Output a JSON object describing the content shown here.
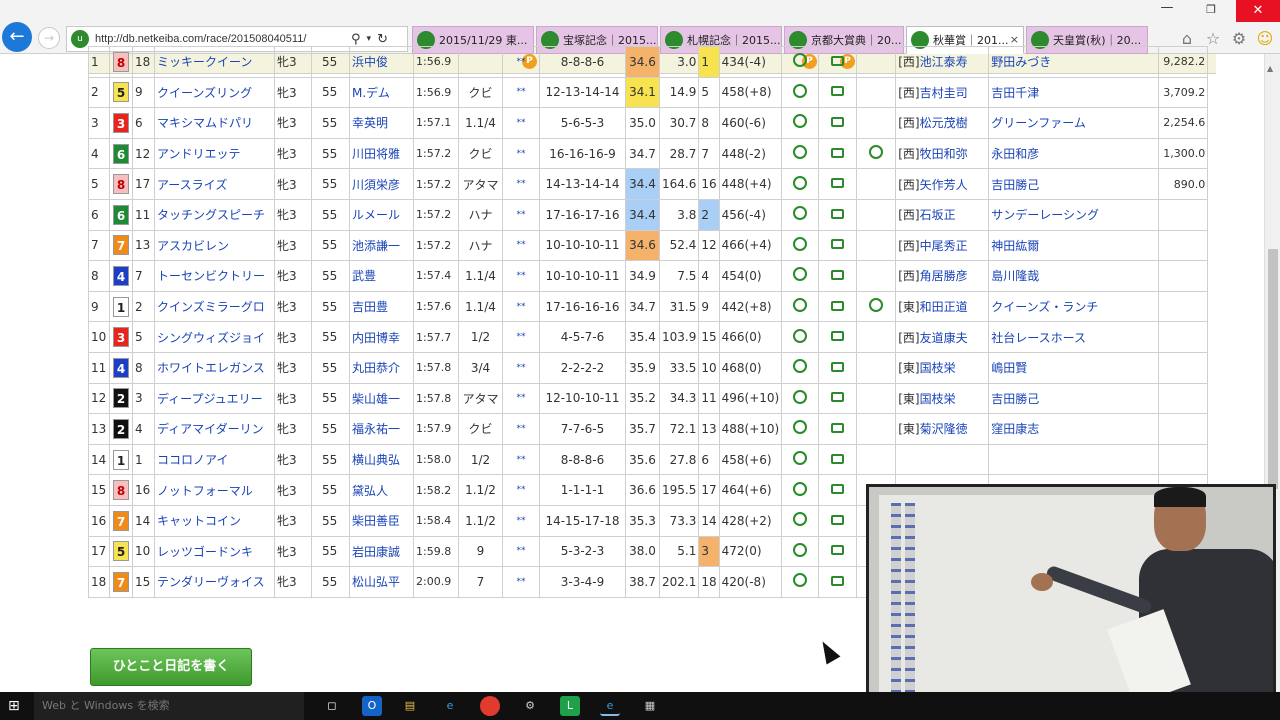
{
  "browser": {
    "url": "http://db.netkeiba.com/race/201508040511/",
    "tabs": [
      {
        "label": "2015/11/29 東...",
        "active": false
      },
      {
        "label": "宝塚記念｜2015...",
        "active": false
      },
      {
        "label": "札幌記念｜2015...",
        "active": false
      },
      {
        "label": "京都大賞典｜20...",
        "active": false
      },
      {
        "label": "秋華賞｜201...",
        "active": true
      },
      {
        "label": "天皇賞(秋)｜20...",
        "active": false
      }
    ],
    "close_tab_glyph": "×"
  },
  "colors": {
    "accent": "#1e78d8",
    "tab_inactive": "#e6c4e6",
    "link_blue": "#1a44b8",
    "orange_cell": "#f5b26b",
    "blue_cell": "#a9cff7",
    "yellow_cell": "#f7e24f",
    "green_icon": "#2b8a2b"
  },
  "icons": {
    "back": "back-arrow-icon",
    "forward": "forward-arrow-icon",
    "search": "search-icon",
    "refresh": "refresh-icon",
    "home": "home-icon",
    "star": "star-icon",
    "gear": "gear-icon",
    "smiley": "smiley-icon",
    "row_icon_a": "clock-icon",
    "row_icon_b": "speech-icon"
  },
  "table": {
    "rows": [
      {
        "rank": "1",
        "waku": "8",
        "waku_color": "#f6c0c0",
        "waku_text": "#c00000",
        "num": "18",
        "name": "ミッキークイーン",
        "sex": "牝3",
        "weight": "55",
        "jockey": "浜中俊",
        "time": "1:56.9",
        "margin": "",
        "mark": "**",
        "passing": "8-8-8-6",
        "f3": "34.6",
        "f3_color": "orange",
        "odds": "3.0",
        "pop": "1",
        "pop_color": "yellow",
        "body": "434(-4)",
        "extra": "",
        "region": "[西]",
        "trainer": "池江泰寿",
        "owner": "野田みづき",
        "prize": "9,282.2"
      },
      {
        "rank": "2",
        "waku": "5",
        "waku_color": "#f7e24f",
        "waku_text": "#222",
        "num": "9",
        "name": "クイーンズリング",
        "sex": "牝3",
        "weight": "55",
        "jockey": "M.デム",
        "time": "1:56.9",
        "margin": "クビ",
        "mark": "**",
        "passing": "12-13-14-14",
        "f3": "34.1",
        "f3_color": "yellow",
        "odds": "14.9",
        "pop": "5",
        "pop_color": "",
        "body": "458(+8)",
        "extra": "",
        "region": "[西]",
        "trainer": "吉村圭司",
        "owner": "吉田千津",
        "prize": "3,709.2"
      },
      {
        "rank": "3",
        "waku": "3",
        "waku_color": "#e8241c",
        "waku_text": "#fff",
        "num": "6",
        "name": "マキシマムドパリ",
        "sex": "牝3",
        "weight": "55",
        "jockey": "幸英明",
        "time": "1:57.1",
        "margin": "1.1/4",
        "mark": "**",
        "passing": "5-6-5-3",
        "f3": "35.0",
        "f3_color": "",
        "odds": "30.7",
        "pop": "8",
        "pop_color": "",
        "body": "460(-6)",
        "extra": "",
        "region": "[西]",
        "trainer": "松元茂樹",
        "owner": "グリーンファーム",
        "prize": "2,254.6"
      },
      {
        "rank": "4",
        "waku": "6",
        "waku_color": "#1f8a35",
        "waku_text": "#fff",
        "num": "12",
        "name": "アンドリエッテ",
        "sex": "牝3",
        "weight": "55",
        "jockey": "川田将雅",
        "time": "1:57.2",
        "margin": "クビ",
        "mark": "**",
        "passing": "16-16-16-9",
        "f3": "34.7",
        "f3_color": "",
        "odds": "28.7",
        "pop": "7",
        "pop_color": "",
        "body": "448(-2)",
        "extra": "!",
        "region": "[西]",
        "trainer": "牧田和弥",
        "owner": "永田和彦",
        "prize": "1,300.0"
      },
      {
        "rank": "5",
        "waku": "8",
        "waku_color": "#f6c0c0",
        "waku_text": "#c00000",
        "num": "17",
        "name": "アースライズ",
        "sex": "牝3",
        "weight": "55",
        "jockey": "川須栄彦",
        "time": "1:57.2",
        "margin": "アタマ",
        "mark": "**",
        "passing": "14-13-14-14",
        "f3": "34.4",
        "f3_color": "blue",
        "odds": "164.6",
        "pop": "16",
        "pop_color": "",
        "body": "448(+4)",
        "extra": "",
        "region": "[西]",
        "trainer": "矢作芳人",
        "owner": "吉田勝己",
        "prize": "890.0"
      },
      {
        "rank": "6",
        "waku": "6",
        "waku_color": "#1f8a35",
        "waku_text": "#fff",
        "num": "11",
        "name": "タッチングスピーチ",
        "sex": "牝3",
        "weight": "55",
        "jockey": "ルメール",
        "time": "1:57.2",
        "margin": "ハナ",
        "mark": "**",
        "passing": "17-16-17-16",
        "f3": "34.4",
        "f3_color": "blue",
        "odds": "3.8",
        "pop": "2",
        "pop_color": "blue",
        "body": "456(-4)",
        "extra": "",
        "region": "[西]",
        "trainer": "石坂正",
        "owner": "サンデーレーシング",
        "prize": ""
      },
      {
        "rank": "7",
        "waku": "7",
        "waku_color": "#f08a18",
        "waku_text": "#fff",
        "num": "13",
        "name": "アスカビレン",
        "sex": "牝3",
        "weight": "55",
        "jockey": "池添謙一",
        "time": "1:57.2",
        "margin": "ハナ",
        "mark": "**",
        "passing": "10-10-10-11",
        "f3": "34.6",
        "f3_color": "orange",
        "odds": "52.4",
        "pop": "12",
        "pop_color": "",
        "body": "466(+4)",
        "extra": "",
        "region": "[西]",
        "trainer": "中尾秀正",
        "owner": "神田紘爾",
        "prize": ""
      },
      {
        "rank": "8",
        "waku": "4",
        "waku_color": "#1d3fc8",
        "waku_text": "#fff",
        "num": "7",
        "name": "トーセンビクトリー",
        "sex": "牝3",
        "weight": "55",
        "jockey": "武豊",
        "time": "1:57.4",
        "margin": "1.1/4",
        "mark": "**",
        "passing": "10-10-10-11",
        "f3": "34.9",
        "f3_color": "",
        "odds": "7.5",
        "pop": "4",
        "pop_color": "",
        "body": "454(0)",
        "extra": "",
        "region": "[西]",
        "trainer": "角居勝彦",
        "owner": "島川隆哉",
        "prize": ""
      },
      {
        "rank": "9",
        "waku": "1",
        "waku_color": "#ffffff",
        "waku_text": "#222",
        "num": "2",
        "name": "クインズミラーグロ",
        "sex": "牝3",
        "weight": "55",
        "jockey": "吉田豊",
        "time": "1:57.6",
        "margin": "1.1/4",
        "mark": "**",
        "passing": "17-16-16-16",
        "f3": "34.7",
        "f3_color": "",
        "odds": "31.5",
        "pop": "9",
        "pop_color": "",
        "body": "442(+8)",
        "extra": "!",
        "region": "[東]",
        "trainer": "和田正道",
        "owner": "クイーンズ・ランチ",
        "prize": ""
      },
      {
        "rank": "10",
        "waku": "3",
        "waku_color": "#e8241c",
        "waku_text": "#fff",
        "num": "5",
        "name": "シングウィズジョイ",
        "sex": "牝3",
        "weight": "55",
        "jockey": "内田博幸",
        "time": "1:57.7",
        "margin": "1/2",
        "mark": "**",
        "passing": "4-5-7-6",
        "f3": "35.4",
        "f3_color": "",
        "odds": "103.9",
        "pop": "15",
        "pop_color": "",
        "body": "466(0)",
        "extra": "",
        "region": "[西]",
        "trainer": "友道康夫",
        "owner": "社台レースホース",
        "prize": ""
      },
      {
        "rank": "11",
        "waku": "4",
        "waku_color": "#1d3fc8",
        "waku_text": "#fff",
        "num": "8",
        "name": "ホワイトエレガンス",
        "sex": "牝3",
        "weight": "55",
        "jockey": "丸田恭介",
        "time": "1:57.8",
        "margin": "3/4",
        "mark": "**",
        "passing": "2-2-2-2",
        "f3": "35.9",
        "f3_color": "",
        "odds": "33.5",
        "pop": "10",
        "pop_color": "",
        "body": "468(0)",
        "extra": "",
        "region": "[東]",
        "trainer": "国枝栄",
        "owner": "嶋田賢",
        "prize": ""
      },
      {
        "rank": "12",
        "waku": "2",
        "waku_color": "#111111",
        "waku_text": "#fff",
        "num": "3",
        "name": "ディープジュエリー",
        "sex": "牝3",
        "weight": "55",
        "jockey": "柴山雄一",
        "time": "1:57.8",
        "margin": "アタマ",
        "mark": "**",
        "passing": "12-10-10-11",
        "f3": "35.2",
        "f3_color": "",
        "odds": "34.3",
        "pop": "11",
        "pop_color": "",
        "body": "496(+10)",
        "extra": "",
        "region": "[東]",
        "trainer": "国枝栄",
        "owner": "吉田勝己",
        "prize": ""
      },
      {
        "rank": "13",
        "waku": "2",
        "waku_color": "#111111",
        "waku_text": "#fff",
        "num": "4",
        "name": "ディアマイダーリン",
        "sex": "牝3",
        "weight": "55",
        "jockey": "福永祐一",
        "time": "1:57.9",
        "margin": "クビ",
        "mark": "**",
        "passing": "7-7-6-5",
        "f3": "35.7",
        "f3_color": "",
        "odds": "72.1",
        "pop": "13",
        "pop_color": "",
        "body": "488(+10)",
        "extra": "",
        "region": "[東]",
        "trainer": "菊沢隆徳",
        "owner": "窪田康志",
        "prize": ""
      },
      {
        "rank": "14",
        "waku": "1",
        "waku_color": "#ffffff",
        "waku_text": "#222",
        "num": "1",
        "name": "ココロノアイ",
        "sex": "牝3",
        "weight": "55",
        "jockey": "横山典弘",
        "time": "1:58.0",
        "margin": "1/2",
        "mark": "**",
        "passing": "8-8-8-6",
        "f3": "35.6",
        "f3_color": "",
        "odds": "27.8",
        "pop": "6",
        "pop_color": "",
        "body": "458(+6)",
        "extra": "",
        "region": "",
        "trainer": "",
        "owner": "",
        "prize": ""
      },
      {
        "rank": "15",
        "waku": "8",
        "waku_color": "#f6c0c0",
        "waku_text": "#c00000",
        "num": "16",
        "name": "ノットフォーマル",
        "sex": "牝3",
        "weight": "55",
        "jockey": "黛弘人",
        "time": "1:58.2",
        "margin": "1.1/2",
        "mark": "**",
        "passing": "1-1-1-1",
        "f3": "36.6",
        "f3_color": "",
        "odds": "195.5",
        "pop": "17",
        "pop_color": "",
        "body": "464(+6)",
        "extra": "",
        "region": "",
        "trainer": "",
        "owner": "",
        "prize": ""
      },
      {
        "rank": "16",
        "waku": "7",
        "waku_color": "#f08a18",
        "waku_text": "#fff",
        "num": "14",
        "name": "キャットコイン",
        "sex": "牝3",
        "weight": "55",
        "jockey": "柴田善臣",
        "time": "1:58.4",
        "margin": "1.1/2",
        "mark": "**",
        "passing": "14-15-17-18",
        "f3": "35.3",
        "f3_color": "",
        "odds": "73.3",
        "pop": "14",
        "pop_color": "",
        "body": "428(+2)",
        "extra": "",
        "region": "",
        "trainer": "",
        "owner": "",
        "prize": ""
      },
      {
        "rank": "17",
        "waku": "5",
        "waku_color": "#f7e24f",
        "waku_text": "#222",
        "num": "10",
        "name": "レッツゴードンキ",
        "sex": "牝3",
        "weight": "55",
        "jockey": "岩田康誠",
        "time": "1:59.8",
        "margin": "9",
        "mark": "**",
        "passing": "5-3-2-3",
        "f3": "38.0",
        "f3_color": "",
        "odds": "5.1",
        "pop": "3",
        "pop_color": "orange",
        "body": "472(0)",
        "extra": "",
        "region": "",
        "trainer": "",
        "owner": "",
        "prize": ""
      },
      {
        "rank": "18",
        "waku": "7",
        "waku_color": "#f08a18",
        "waku_text": "#fff",
        "num": "15",
        "name": "テンダリーヴォイス",
        "sex": "牝3",
        "weight": "55",
        "jockey": "松山弘平",
        "time": "2:00.9",
        "margin": "7",
        "mark": "**",
        "passing": "3-3-4-9",
        "f3": "38.7",
        "f3_color": "",
        "odds": "202.1",
        "pop": "18",
        "pop_color": "",
        "body": "420(-8)",
        "extra": "",
        "region": "",
        "trainer": "",
        "owner": "",
        "prize": ""
      }
    ]
  },
  "diary_button": "ひとこと日記を書く",
  "taskbar": {
    "search_placeholder": "Web と Windows を検索"
  }
}
